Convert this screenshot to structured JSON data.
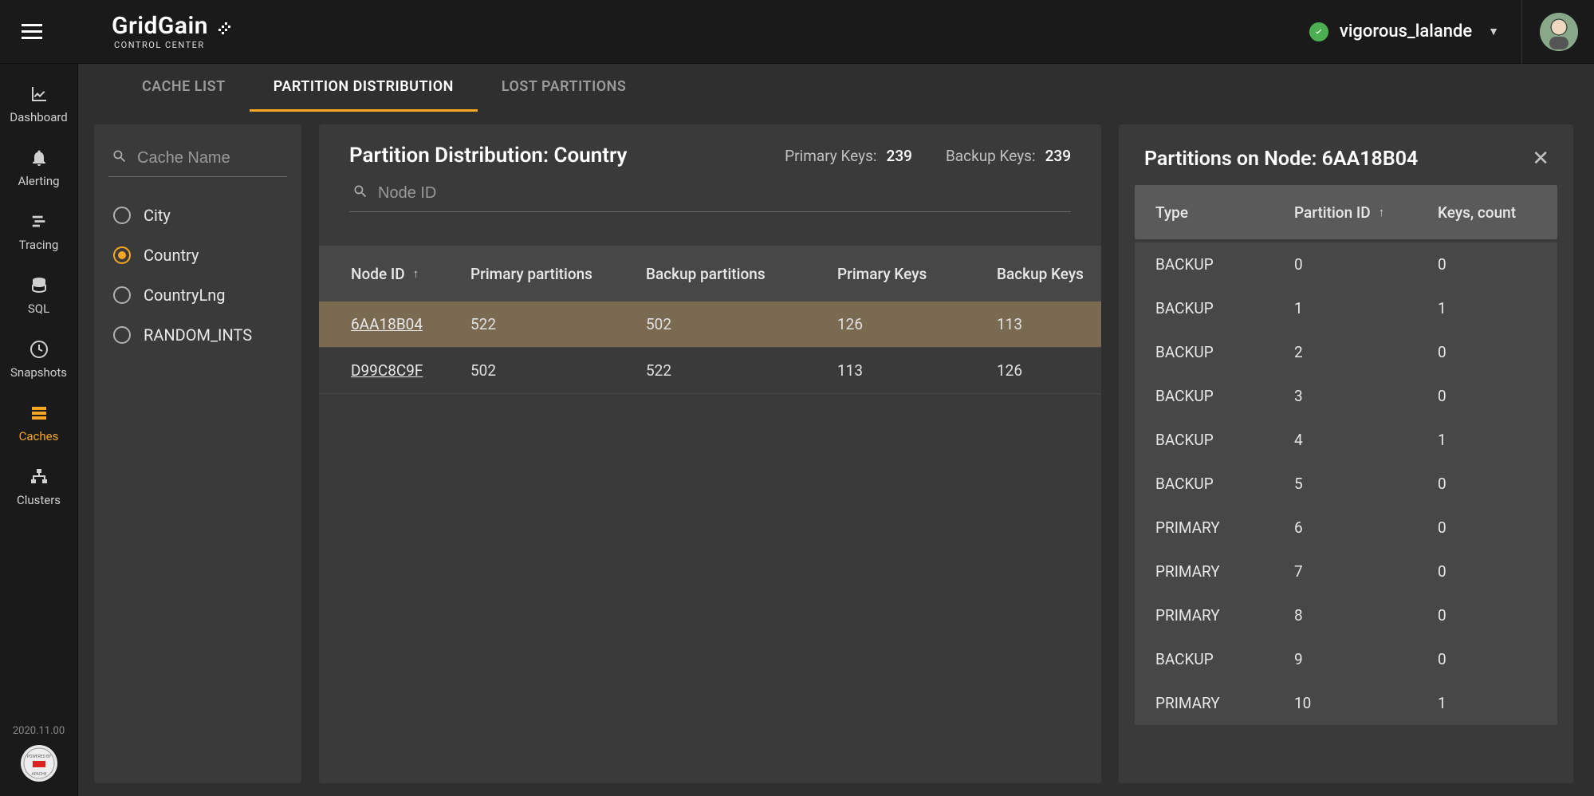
{
  "app": {
    "brand_main": "GridGain",
    "brand_sub": "CONTROL CENTER",
    "version": "2020.11.00",
    "powered_label": "POWERED BY APACHE"
  },
  "topbar": {
    "cluster_name": "vigorous_lalande"
  },
  "sidebar": {
    "items": [
      {
        "label": "Dashboard",
        "icon": "chart",
        "active": false
      },
      {
        "label": "Alerting",
        "icon": "bell",
        "active": false
      },
      {
        "label": "Tracing",
        "icon": "trace",
        "active": false
      },
      {
        "label": "SQL",
        "icon": "db",
        "active": false
      },
      {
        "label": "Snapshots",
        "icon": "clock",
        "active": false
      },
      {
        "label": "Caches",
        "icon": "stack",
        "active": true
      },
      {
        "label": "Clusters",
        "icon": "topo",
        "active": false
      }
    ]
  },
  "tabs": [
    {
      "label": "CACHE LIST",
      "active": false
    },
    {
      "label": "PARTITION DISTRIBUTION",
      "active": true
    },
    {
      "label": "LOST PARTITIONS",
      "active": false
    }
  ],
  "cache_panel": {
    "search_placeholder": "Cache Name",
    "items": [
      {
        "label": "City",
        "selected": false
      },
      {
        "label": "Country",
        "selected": true
      },
      {
        "label": "CountryLng",
        "selected": false
      },
      {
        "label": "RANDOM_INTS",
        "selected": false
      }
    ]
  },
  "main": {
    "title": "Partition Distribution: Country",
    "primary_keys_label": "Primary Keys:",
    "primary_keys_value": "239",
    "backup_keys_label": "Backup Keys:",
    "backup_keys_value": "239",
    "node_search_placeholder": "Node ID",
    "columns": {
      "node_id": "Node ID",
      "primary_partitions": "Primary partitions",
      "backup_partitions": "Backup partitions",
      "primary_keys": "Primary Keys",
      "backup_keys": "Backup Keys"
    },
    "rows": [
      {
        "node_id": "6AA18B04",
        "pp": "522",
        "bp": "502",
        "pk": "126",
        "bk": "113",
        "selected": true
      },
      {
        "node_id": "D99C8C9F",
        "pp": "502",
        "bp": "522",
        "pk": "113",
        "bk": "126",
        "selected": false
      }
    ]
  },
  "detail": {
    "title": "Partitions on Node: 6AA18B04",
    "columns": {
      "type": "Type",
      "partition_id": "Partition ID",
      "keys_count": "Keys, count"
    },
    "rows": [
      {
        "type": "BACKUP",
        "pid": "0",
        "keys": "0"
      },
      {
        "type": "BACKUP",
        "pid": "1",
        "keys": "1"
      },
      {
        "type": "BACKUP",
        "pid": "2",
        "keys": "0"
      },
      {
        "type": "BACKUP",
        "pid": "3",
        "keys": "0"
      },
      {
        "type": "BACKUP",
        "pid": "4",
        "keys": "1"
      },
      {
        "type": "BACKUP",
        "pid": "5",
        "keys": "0"
      },
      {
        "type": "PRIMARY",
        "pid": "6",
        "keys": "0"
      },
      {
        "type": "PRIMARY",
        "pid": "7",
        "keys": "0"
      },
      {
        "type": "PRIMARY",
        "pid": "8",
        "keys": "0"
      },
      {
        "type": "BACKUP",
        "pid": "9",
        "keys": "0"
      },
      {
        "type": "PRIMARY",
        "pid": "10",
        "keys": "1"
      }
    ]
  }
}
